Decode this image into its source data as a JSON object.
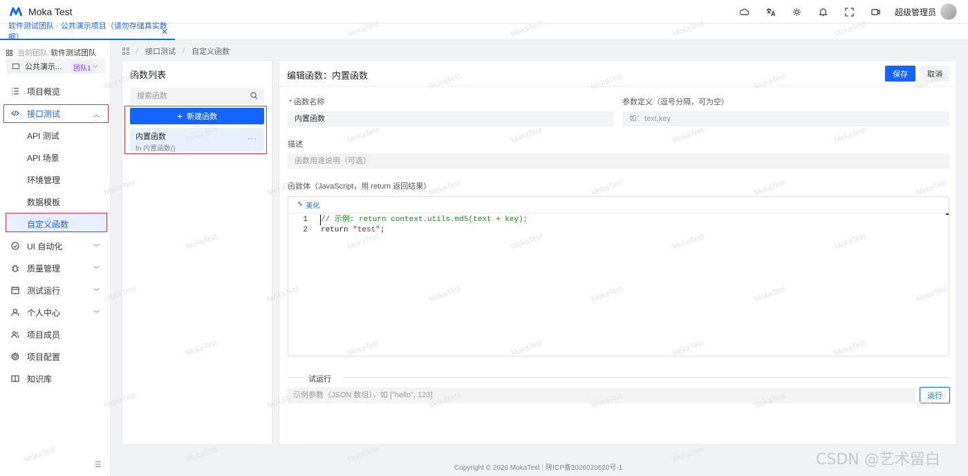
{
  "app": {
    "title": "Moka Test"
  },
  "header": {
    "username": "超级管理员"
  },
  "tabs": [
    {
      "label": "软件测试团队 · 公共演示项目（请勿存储真实数据）",
      "close": "✕"
    }
  ],
  "sidebar": {
    "team_prefix": "当前团队",
    "team_name": "软件测试团队",
    "project_name": "公共演示...",
    "project_badge": "团队1",
    "menu": [
      {
        "label": "项目概览"
      },
      {
        "label": "接口测试"
      },
      {
        "label": "API 测试"
      },
      {
        "label": "API 场景"
      },
      {
        "label": "环境管理"
      },
      {
        "label": "数据模板"
      },
      {
        "label": "自定义函数"
      },
      {
        "label": "UI 自动化"
      },
      {
        "label": "质量管理"
      },
      {
        "label": "测试运行"
      },
      {
        "label": "个人中心"
      },
      {
        "label": "项目成员"
      },
      {
        "label": "项目配置"
      },
      {
        "label": "知识库"
      }
    ]
  },
  "breadcrumb": {
    "items": [
      "接口测试",
      "自定义函数"
    ],
    "sep": "/"
  },
  "function_list": {
    "title": "函数列表",
    "search_placeholder": "搜索函数",
    "new_button": "新建函数",
    "new_button_icon": "+",
    "items": [
      {
        "name": "内置函数",
        "signature": "fn 内置函数()",
        "more": "···"
      }
    ]
  },
  "editor": {
    "title": "编辑函数：内置函数",
    "save": "保存",
    "cancel": "取消",
    "name_label": "函数名称",
    "name_required": "*",
    "name_value": "内置函数",
    "params_label": "参数定义（逗号分隔，可为空）",
    "params_placeholder": "如：text,key",
    "desc_label": "描述",
    "desc_placeholder": "函数用途说明（可选）",
    "body_label": "函数体（JavaScript，用 return 返回结果）",
    "beautify": "美化",
    "code": {
      "line1_num": "1",
      "line1": "// 示例: return context.utils.md5(text + key);",
      "line2_num": "2",
      "line2_kw": "return ",
      "line2_str": "\"test\"",
      "line2_end": ";"
    },
    "try_label": "试运行",
    "try_placeholder": "示例参数（JSON 数组），如 [\"hello\", 123]",
    "run": "运行"
  },
  "footer": {
    "copyright": "Copyright © 2026 MokaTest",
    "icp": "陕ICP备2026020620号-1"
  },
  "watermark": {
    "text": "MokaTest",
    "csdn": "CSDN @艺术留白"
  },
  "colors": {
    "accent": "#1664ff",
    "highlight_box": "#d9363e"
  }
}
